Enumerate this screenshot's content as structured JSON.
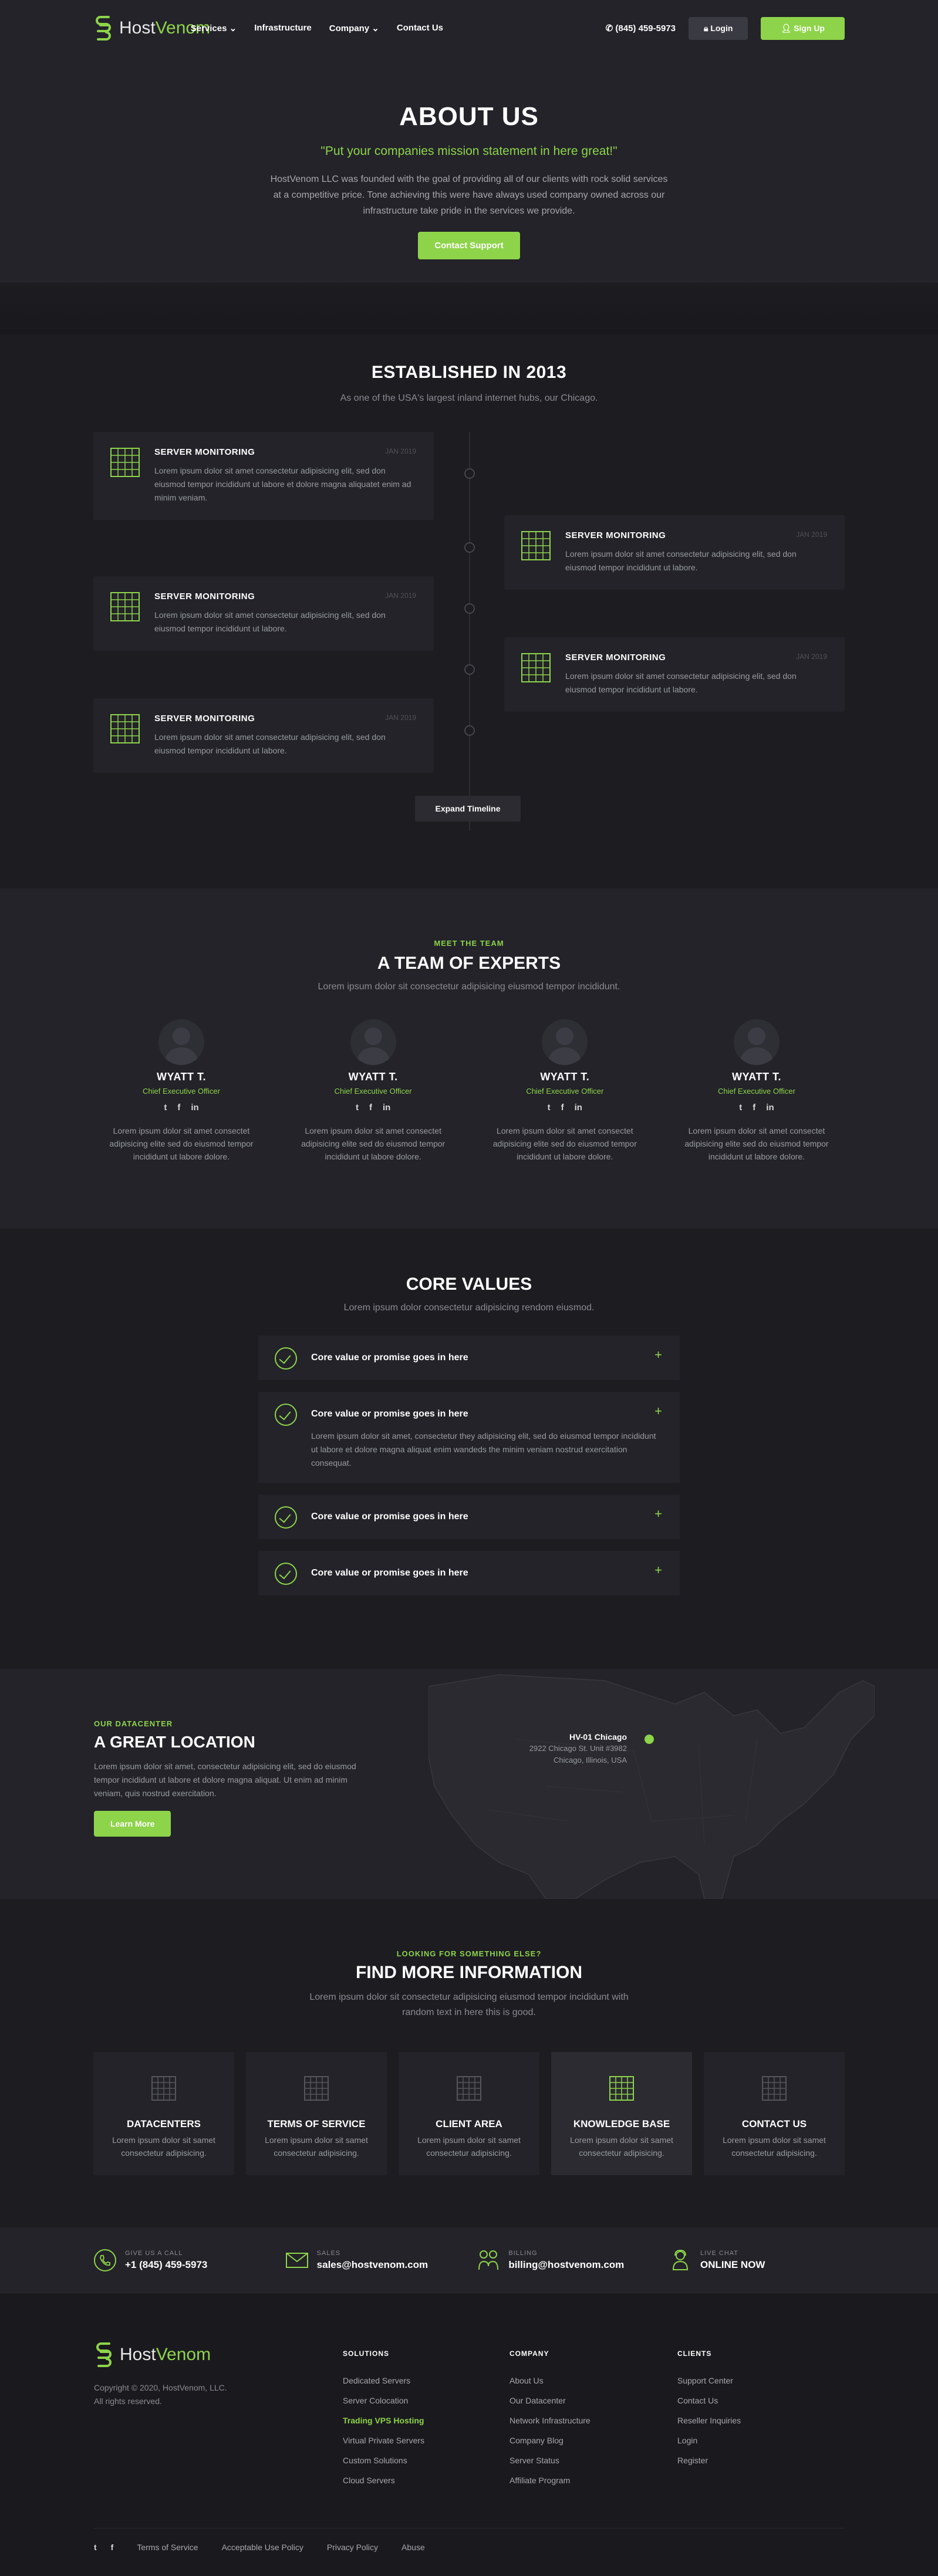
{
  "header": {
    "logo_host": "Host",
    "logo_venom": "Venom",
    "menu": [
      "Services ⌄",
      "Infrastructure",
      "Company ⌄",
      "Contact Us"
    ],
    "phone": "(845) 459-5973",
    "login": "Login",
    "signup": "Sign Up"
  },
  "hero": {
    "title": "ABOUT US",
    "subtitle": "\"Put your companies mission statement in here great!\"",
    "text": "HostVenom LLC was founded with the goal of providing all of our clients with rock solid services at a competitive price. Tone achieving this were have always used company owned across our infrastructure take pride in the services we provide.",
    "cta": "Contact Support"
  },
  "established": {
    "title": "ESTABLISHED IN 2013",
    "subtitle": "As one of the USA's largest inland internet hubs, our Chicago.",
    "cards": [
      {
        "title": "SERVER MONITORING",
        "date": "JAN 2019",
        "text": "Lorem ipsum dolor sit amet consectetur adipisicing elit, sed don eiusmod tempor incididunt ut labore et dolore magna aliquatet enim ad minim veniam."
      },
      {
        "title": "SERVER MONITORING",
        "date": "JAN 2019",
        "text": "Lorem ipsum dolor sit amet consectetur adipisicing elit, sed don eiusmod tempor incididunt ut labore."
      },
      {
        "title": "SERVER MONITORING",
        "date": "JAN 2019",
        "text": "Lorem ipsum dolor sit amet consectetur adipisicing elit, sed don eiusmod tempor incididunt ut labore."
      },
      {
        "title": "SERVER MONITORING",
        "date": "JAN 2019",
        "text": "Lorem ipsum dolor sit amet consectetur adipisicing elit, sed don eiusmod tempor incididunt ut labore."
      },
      {
        "title": "SERVER MONITORING",
        "date": "JAN 2019",
        "text": "Lorem ipsum dolor sit amet consectetur adipisicing elit, sed don eiusmod tempor incididunt ut labore."
      }
    ],
    "expand": "Expand Timeline"
  },
  "team": {
    "kicker": "MEET THE TEAM",
    "title": "A TEAM OF EXPERTS",
    "subtitle": "Lorem ipsum dolor sit consectetur adipisicing eiusmod tempor incididunt.",
    "members": [
      {
        "name": "WYATT T.",
        "role": "Chief Executive Officer",
        "text": "Lorem ipsum dolor sit amet consectet adipisicing elite sed do eiusmod tempor incididunt ut labore dolore."
      },
      {
        "name": "WYATT T.",
        "role": "Chief Executive Officer",
        "text": "Lorem ipsum dolor sit amet consectet adipisicing elite sed do eiusmod tempor incididunt ut labore dolore."
      },
      {
        "name": "WYATT T.",
        "role": "Chief Executive Officer",
        "text": "Lorem ipsum dolor sit amet consectet adipisicing elite sed do eiusmod tempor incididunt ut labore dolore."
      },
      {
        "name": "WYATT T.",
        "role": "Chief Executive Officer",
        "text": "Lorem ipsum dolor sit amet consectet adipisicing elite sed do eiusmod tempor incididunt ut labore dolore."
      }
    ],
    "social": [
      "t",
      "f",
      "in"
    ]
  },
  "values": {
    "title": "CORE VALUES",
    "subtitle": "Lorem ipsum dolor consectetur adipisicing rendom eiusmod.",
    "items": [
      {
        "label": "Core value or promise goes in here",
        "text": ""
      },
      {
        "label": "Core value or promise goes in here",
        "text": "Lorem ipsum dolor sit amet, consectetur they adipisicing elit, sed do eiusmod tempor incididunt ut labore et dolore magna aliquat enim wandeds the minim veniam nostrud exercitation consequat."
      },
      {
        "label": "Core value or promise goes in here",
        "text": ""
      },
      {
        "label": "Core value or promise goes in here",
        "text": ""
      }
    ]
  },
  "location": {
    "kicker": "OUR DATACENTER",
    "title": "A GREAT LOCATION",
    "text": "Lorem ipsum dolor sit amet, consectetur adipisicing elit, sed do eiusmod tempor incididunt ut labore et dolore magna aliquat. Ut enim ad minim veniam, quis nostrud exercitation.",
    "cta": "Learn More",
    "pin_title": "HV-01 Chicago",
    "pin_addr1": "2922 Chicago St. Unit #3982",
    "pin_addr2": "Chicago, Illinois, USA"
  },
  "more": {
    "kicker": "LOOKING FOR SOMETHING ELSE?",
    "title": "FIND MORE INFORMATION",
    "subtitle": "Lorem ipsum dolor sit consectetur adipisicing eiusmod tempor incididunt with random text in here this is good.",
    "tiles": [
      {
        "title": "DATACENTERS",
        "text": "Lorem ipsum dolor sit samet consectetur adipisicing."
      },
      {
        "title": "TERMS OF SERVICE",
        "text": "Lorem ipsum dolor sit samet consectetur adipisicing."
      },
      {
        "title": "CLIENT AREA",
        "text": "Lorem ipsum dolor sit samet consectetur adipisicing."
      },
      {
        "title": "KNOWLEDGE BASE",
        "text": "Lorem ipsum dolor sit samet consectetur adipisicing."
      },
      {
        "title": "CONTACT US",
        "text": "Lorem ipsum dolor sit samet consectetur adipisicing."
      }
    ]
  },
  "contact": [
    {
      "label": "GIVE US A CALL",
      "value": "+1 (845) 459-5973"
    },
    {
      "label": "SALES",
      "value": "sales@hostvenom.com"
    },
    {
      "label": "BILLING",
      "value": "billing@hostvenom.com"
    },
    {
      "label": "LIVE CHAT",
      "value": "ONLINE NOW"
    }
  ],
  "footer": {
    "copyright": "Copyright © 2020, HostVenom, LLC.",
    "rights": "All rights reserved.",
    "solutions_title": "SOLUTIONS",
    "solutions": [
      "Dedicated Servers",
      "Server Colocation",
      "Trading VPS Hosting",
      "Virtual Private Servers",
      "Custom Solutions",
      "Cloud Servers"
    ],
    "company_title": "COMPANY",
    "company": [
      "About Us",
      "Our Datacenter",
      "Network Infrastructure",
      "Company Blog",
      "Server Status",
      "Affiliate Program"
    ],
    "clients_title": "CLIENTS",
    "clients": [
      "Support Center",
      "Contact Us",
      "Reseller Inquiries",
      "Login",
      "Register"
    ],
    "social": [
      "t",
      "f"
    ],
    "links": [
      "Terms of Service",
      "Acceptable Use Policy",
      "Privacy Policy",
      "Abuse"
    ]
  },
  "colors": {
    "accent": "#8ed44a",
    "bg": "#1c1c21",
    "panel": "#232329"
  }
}
